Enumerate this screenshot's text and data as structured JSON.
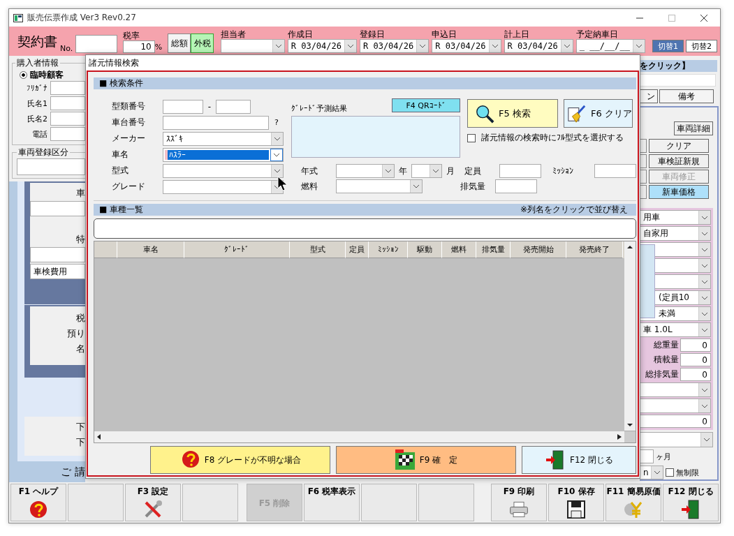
{
  "window": {
    "title": "販売伝票作成 Ver3 Rev0.27"
  },
  "header": {
    "title": "契約書",
    "no_label": "No.",
    "tax_label": "税率",
    "tax_rate": "10",
    "tax_unit": "%",
    "tax_modes": [
      {
        "label": "総額",
        "selected": false
      },
      {
        "label": "外税",
        "selected": true
      }
    ],
    "date_fields": [
      {
        "label": "担当者"
      },
      {
        "label": "作成日",
        "value": "R 03/04/26"
      },
      {
        "label": "登録日",
        "value": "R 03/04/26"
      },
      {
        "label": "申込日",
        "value": "R 03/04/26"
      },
      {
        "label": "計上日",
        "value": "R 03/04/26"
      },
      {
        "label": "予定納車日",
        "value": "_ __/__/__"
      }
    ],
    "switches": [
      {
        "label": "切替1",
        "selected": true
      },
      {
        "label": "切替2",
        "selected": false
      }
    ]
  },
  "buyer": {
    "legend": "購入者情報",
    "customer_type": {
      "label": "臨時顧客",
      "selected": true
    },
    "fields": [
      {
        "label": "ﾌﾘｶﾞﾅ"
      },
      {
        "label": "氏名1"
      },
      {
        "label": "氏名2"
      },
      {
        "label": "電話"
      }
    ]
  },
  "registration": {
    "legend": "車両登録区分"
  },
  "left_panel": {
    "vehicle_labels": [
      "車",
      "特"
    ],
    "inspection_fee": "車検費用",
    "total_labels": [
      "税",
      "預り",
      "名"
    ],
    "lower_labels": [
      "下",
      "下"
    ],
    "footer": "ご 請"
  },
  "right_panel": {
    "banner": "をクリック】",
    "tabs": [
      "ン",
      "備考"
    ],
    "detail_button": "車両詳細",
    "buttons": [
      {
        "label": "クリア",
        "disabled": false,
        "highlighted": false
      },
      {
        "label": "車検証新規",
        "disabled": false,
        "highlighted": false
      },
      {
        "label": "車両修正",
        "disabled": true,
        "highlighted": false
      },
      {
        "label": "新車価格",
        "disabled": false,
        "highlighted": true
      }
    ],
    "form": [
      {
        "kind": "select",
        "value": "用車"
      },
      {
        "kind": "select",
        "value": "自家用"
      },
      {
        "kind": "select"
      },
      {
        "kind": "select"
      },
      {
        "kind": "select"
      },
      {
        "kind": "select",
        "value": "(定員10"
      },
      {
        "kind": "select",
        "value": "未満"
      },
      {
        "kind": "select",
        "value": "車 1.0L"
      },
      {
        "kind": "measure",
        "label": "総重量",
        "value": "0"
      },
      {
        "kind": "measure",
        "label": "積載量",
        "value": "0"
      },
      {
        "kind": "measure",
        "label": "総排気量",
        "value": "0"
      },
      {
        "kind": "select"
      },
      {
        "kind": "select"
      },
      {
        "kind": "number",
        "value": "0"
      }
    ],
    "term_unit": "ヶ月",
    "mileage_value": "n",
    "unlimited": {
      "label": "無制限",
      "checked": false
    }
  },
  "function_keys": [
    {
      "kind": "key",
      "label": "F1 ヘルプ",
      "disabled": false
    },
    {
      "kind": "blank",
      "disabled": false
    },
    {
      "kind": "key",
      "label": "F3 設定",
      "disabled": false
    },
    {
      "kind": "blank",
      "disabled": false
    },
    {
      "kind": "key",
      "label": "F5 削除",
      "disabled": true
    },
    {
      "kind": "key",
      "label": "F6 税率表示",
      "disabled": false
    },
    {
      "kind": "blank",
      "disabled": false
    },
    {
      "kind": "blank",
      "disabled": false
    },
    {
      "kind": "key",
      "label": "F9 印刷",
      "disabled": false
    },
    {
      "kind": "key",
      "label": "F10 保存",
      "disabled": false
    },
    {
      "kind": "key",
      "label": "F11 簡易原価",
      "disabled": false
    },
    {
      "kind": "key",
      "label": "F12 閉じる",
      "disabled": false
    }
  ],
  "dialog": {
    "title": "諸元情報検索",
    "conditions": {
      "heading": "■ 検索条件",
      "type_number": {
        "label": "型類番号",
        "separator": "-"
      },
      "chassis": {
        "label": "車台番号",
        "hint": "?"
      },
      "selects": [
        {
          "label": "メーカー",
          "value": "ｽｽﾞｷ",
          "focused": false
        },
        {
          "label": "車名",
          "value": "ﾊｽﾗｰ",
          "focused": true
        },
        {
          "label": "型式",
          "focused": false
        },
        {
          "label": "グレード",
          "focused": false
        }
      ],
      "prediction_label": "ｸﾞﾚｰﾄﾞ予測結果",
      "qr_button": "F4 QRｺｰﾄﾞ",
      "search_button": "F5 検索",
      "clear_button": "F6 クリア",
      "full_model": {
        "label": "諸元情報の検索時にﾌﾙ型式を選択する",
        "checked": false
      },
      "year": {
        "label": "年式",
        "year_unit": "年",
        "month_unit": "月"
      },
      "fuel": {
        "label": "燃料"
      },
      "capacity": {
        "label": "定員"
      },
      "displacement": {
        "label": "排気量"
      },
      "transmission": {
        "label": "ﾐｯｼｮﾝ"
      }
    },
    "list": {
      "heading": "■ 車種一覧",
      "note": "※列名をクリックで並び替え",
      "columns": [
        "車名",
        "ｸﾞﾚｰﾄﾞ",
        "型式",
        "定員",
        "ﾐｯｼｮﾝ",
        "駆動",
        "燃料",
        "排気量",
        "発売開始",
        "発売終了"
      ]
    },
    "actions": [
      {
        "kind": "unknown",
        "label": "F8 グレードが不明な場合"
      },
      {
        "kind": "confirm",
        "label": "F9 確　定"
      },
      {
        "kind": "close",
        "label": "F12 閉じる"
      }
    ]
  }
}
